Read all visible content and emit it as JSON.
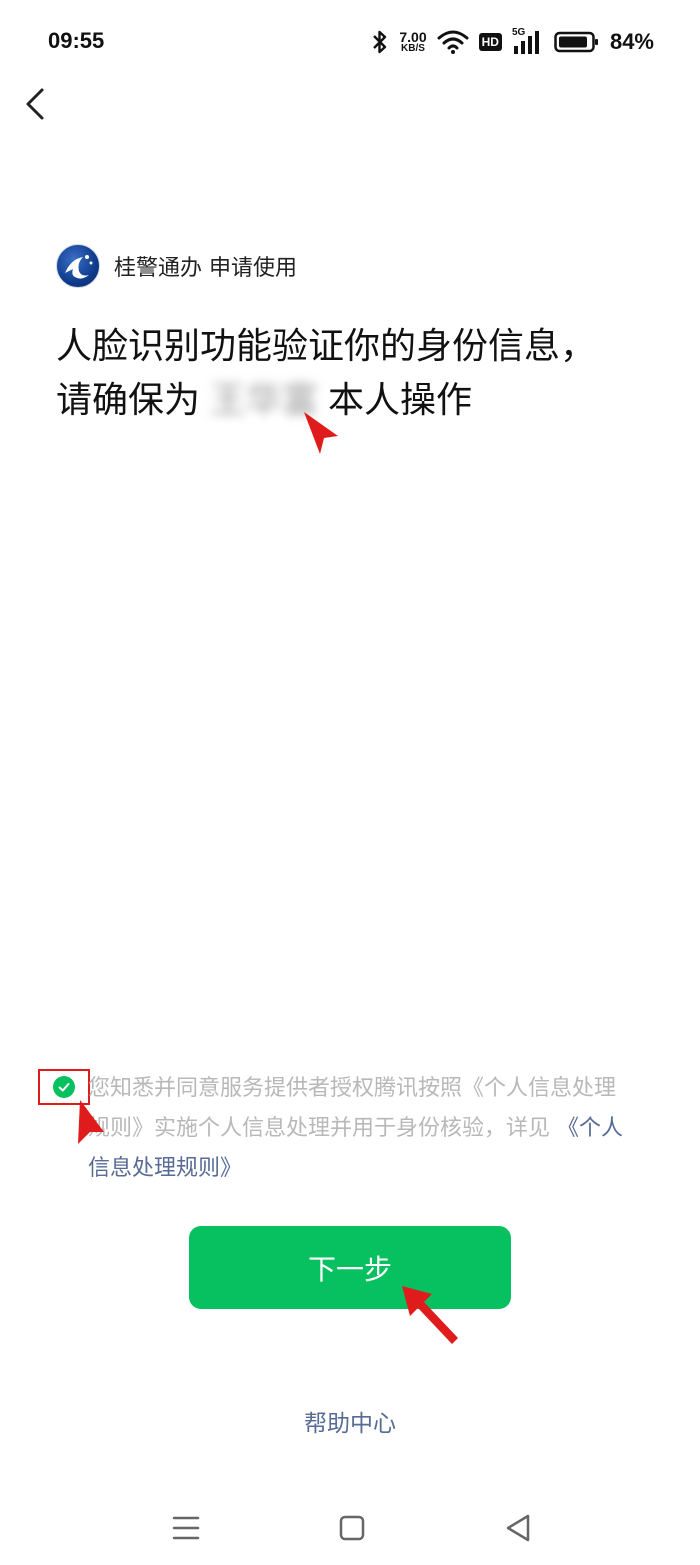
{
  "status_bar": {
    "time": "09:55",
    "net_speed_value": "7.00",
    "net_speed_unit": "KB/S",
    "hd_badge": "HD",
    "signal_label": "5G",
    "battery_percent": "84%"
  },
  "app": {
    "name": "桂警通办",
    "request_text": "申请使用"
  },
  "headline": {
    "line1": "人脸识别功能验证你的身份信息，",
    "line2_prefix": "请确保为",
    "masked_name": "王华富",
    "line2_suffix": "本人操作"
  },
  "consent": {
    "checked": true,
    "text": "您知悉并同意服务提供者授权腾讯按照《个人信息处理规则》实施个人信息处理并用于身份核验，详见",
    "link_text": "《个人信息处理规则》"
  },
  "next_button_label": "下一步",
  "help_link": "帮助中心",
  "colors": {
    "primary_green": "#07c160",
    "link_blue": "#576b95",
    "annotation_red": "#e01b1b"
  }
}
